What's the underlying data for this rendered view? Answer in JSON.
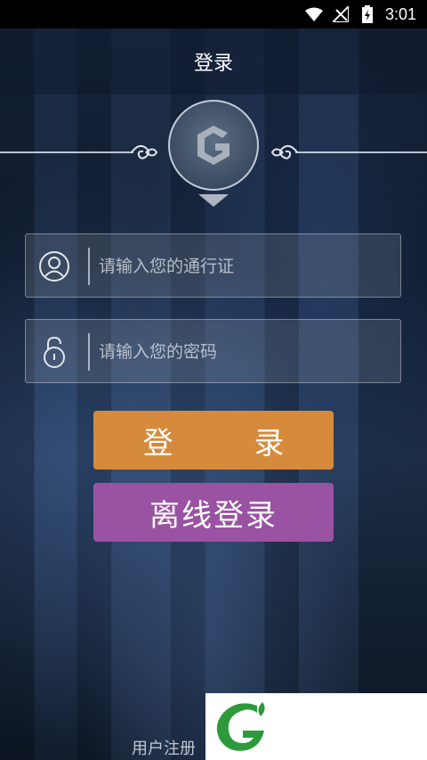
{
  "status_bar": {
    "time": "3:01"
  },
  "header": {
    "title": "登录"
  },
  "form": {
    "account_placeholder": "请输入您的通行证",
    "password_placeholder": "请输入您的密码"
  },
  "buttons": {
    "login_label": "登 录",
    "offline_label": "离线登录"
  },
  "footer": {
    "register_label": "用户注册"
  },
  "colors": {
    "login_button": "#d58a3c",
    "offline_button": "#9a52a3",
    "brand_green": "#2c9a3a"
  }
}
